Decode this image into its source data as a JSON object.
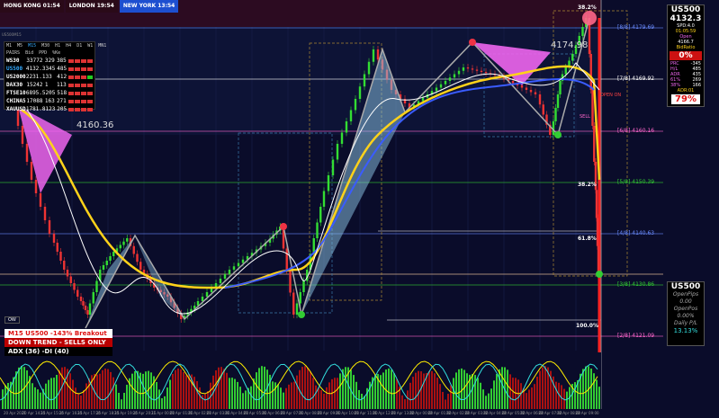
{
  "sessions": {
    "hong_kong": "HONG KONG 01:54",
    "london": "LONDON 19:54",
    "new_york": "NEW YORK 13:54"
  },
  "top_left_text": "US500M15",
  "info_table": {
    "headers": [
      "M1",
      "M5",
      "M15",
      "M30",
      "H1",
      "H4",
      "D1",
      "W1",
      "MN1"
    ],
    "subheaders": [
      "PAIRS",
      "Bid",
      "PPD",
      "%Ke"
    ],
    "rows": [
      {
        "symbol": "WS30",
        "bid": "33772",
        "ppd": "329",
        "pct": "385",
        "hl": false
      },
      {
        "symbol": "US500",
        "bid": "4132.3",
        "ppd": "345",
        "pct": "485",
        "hl": true
      },
      {
        "symbol": "US2000",
        "bid": "2231.1",
        "ppd": "33",
        "pct": "412",
        "hl": false
      },
      {
        "symbol": "DAX30",
        "bid": "15242",
        "ppd": "1",
        "pct": "113",
        "hl": false
      },
      {
        "symbol": "FTSE10",
        "bid": "6895.5",
        "ppd": "205",
        "pct": "518",
        "hl": false
      },
      {
        "symbol": "CHINA5",
        "bid": "17088",
        "ppd": "163",
        "pct": "271",
        "hl": false
      },
      {
        "symbol": "XAUUSD",
        "bid": "1781.8",
        "ppd": "123",
        "pct": "205",
        "hl": false
      }
    ]
  },
  "right_panel": {
    "symbol": "US500",
    "price": "4132.3",
    "spread": "SPD:4.0",
    "time": "01:05:59",
    "open_label": "Open",
    "open": "4166.7",
    "bid_ratio_label": "BidRatio",
    "bid_ratio": "0%",
    "stats": [
      {
        "k": "PRC",
        "v": "-345"
      },
      {
        "k": "H/L",
        "v": "485"
      },
      {
        "k": "ADR",
        "v": "435"
      },
      {
        "k": "61%",
        "v": "269"
      },
      {
        "k": "38%",
        "v": "166"
      }
    ],
    "adr_label": "ADR:01",
    "adr_pct": "79%"
  },
  "right_panel2": {
    "symbol": "US500",
    "open_pips": "OpenPips",
    "zero": "0.00",
    "open_pos": "OpenPos",
    "zero_pct": "0.00%",
    "daily": "Daily P/L",
    "daily_val": "13.13%"
  },
  "breakout": {
    "line1": "M15 US500 -143% Breakout",
    "line2": "DOWN TREND - SELLS ONLY",
    "line3": "ADX (36)  -DI (40)"
  },
  "chart_labels": {
    "price_4174": "4174.98",
    "price_4160": "4160.36",
    "open_on": "OPEN ON",
    "sell": "SELL",
    "pct_382_top": "38.2%",
    "pct_382": "38.2%",
    "pct_618": "61.8%",
    "pct_100": "100.0%",
    "ow": "OW"
  },
  "murrey_levels": [
    {
      "label": "[8/8]",
      "value": "4179.69",
      "y": 31,
      "color": "#6a8cff"
    },
    {
      "label": "[7/8]",
      "value": "4169.92",
      "y": 88,
      "color": "#ffffff"
    },
    {
      "label": "[6/8]",
      "value": "4160.16",
      "y": 146,
      "color": "#ff66cc"
    },
    {
      "label": "[5/8]",
      "value": "4150.39",
      "y": 203,
      "color": "#33cc33"
    },
    {
      "label": "[4/8]",
      "value": "4140.63",
      "y": 260,
      "color": "#6a8cff"
    },
    {
      "label": "[3/8]",
      "value": "4130.86",
      "y": 317,
      "color": "#33cc33"
    },
    {
      "label": "[2/8]",
      "value": "4121.09",
      "y": 374,
      "color": "#ff66cc"
    }
  ],
  "x_ticks": [
    "20 Apr 2021",
    "20 Apr 14:15",
    "20 Apr 15:15",
    "20 Apr 16:15",
    "20 Apr 17:15",
    "20 Apr 18:15",
    "20 Apr 19:15",
    "20 Apr 20:15",
    "21 Apr 00:00",
    "21 Apr 01:00",
    "21 Apr 02:00",
    "21 Apr 03:00",
    "21 Apr 04:00",
    "21 Apr 05:00",
    "21 Apr 06:00",
    "21 Apr 07:00",
    "21 Apr 08:00",
    "21 Apr 09:00",
    "21 Apr 10:00",
    "21 Apr 11:00",
    "21 Apr 12:00",
    "21 Apr 13:00",
    "22 Apr 00:00",
    "22 Apr 01:00",
    "22 Apr 02:00",
    "22 Apr 03:00",
    "22 Apr 04:00",
    "22 Apr 05:00",
    "22 Apr 06:00",
    "22 Apr 07:00",
    "22 Apr 08:00",
    "22 Apr 09:00"
  ],
  "colors": {
    "bg": "#0a0c2a",
    "bull": "#33dd33",
    "bear": "#ee3333",
    "ma_yellow": "#ffd21a",
    "ma_blue": "#3a5cff",
    "ma_white": "#ffffff",
    "pattern_pink": "#ee66ee",
    "pattern_blue": "#8ec8e8"
  }
}
